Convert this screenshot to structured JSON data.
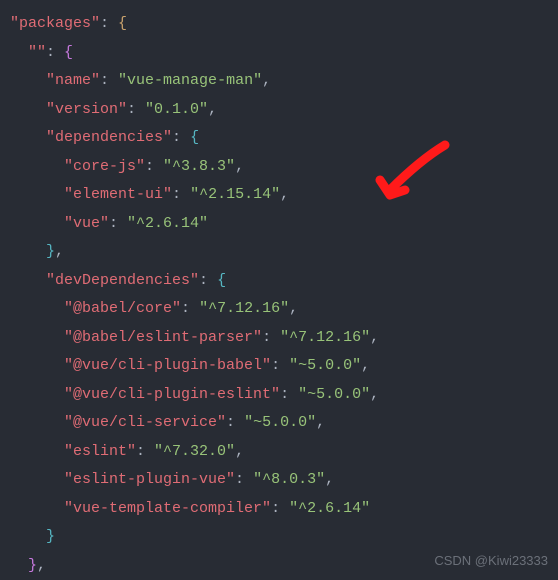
{
  "code": {
    "l1_key": "\"packages\"",
    "l1_after": ": ",
    "l1_brace": "{",
    "l2_key": "\"\"",
    "l2_after": ": ",
    "l2_brace": "{",
    "l3_key": "\"name\"",
    "l3_val": "\"vue-manage-man\"",
    "l4_key": "\"version\"",
    "l4_val": "\"0.1.0\"",
    "l5_key": "\"dependencies\"",
    "l5_after": ": ",
    "l5_brace": "{",
    "l6_key": "\"core-js\"",
    "l6_val": "\"^3.8.3\"",
    "l7_key": "\"element-ui\"",
    "l7_val": "\"^2.15.14\"",
    "l8_key": "\"vue\"",
    "l8_val": "\"^2.6.14\"",
    "l9_brace": "}",
    "l10_key": "\"devDependencies\"",
    "l10_after": ": ",
    "l10_brace": "{",
    "l11_key": "\"@babel/core\"",
    "l11_val": "\"^7.12.16\"",
    "l12_key": "\"@babel/eslint-parser\"",
    "l12_val": "\"^7.12.16\"",
    "l13_key": "\"@vue/cli-plugin-babel\"",
    "l13_val": "\"~5.0.0\"",
    "l14_key": "\"@vue/cli-plugin-eslint\"",
    "l14_val": "\"~5.0.0\"",
    "l15_key": "\"@vue/cli-service\"",
    "l15_val": "\"~5.0.0\"",
    "l16_key": "\"eslint\"",
    "l16_val": "\"^7.32.0\"",
    "l17_key": "\"eslint-plugin-vue\"",
    "l17_val": "\"^8.0.3\"",
    "l18_key": "\"vue-template-compiler\"",
    "l18_val": "\"^2.6.14\"",
    "l19_brace": "}",
    "l20_brace": "}",
    "comma": ","
  },
  "watermark": "CSDN @Kiwi23333"
}
